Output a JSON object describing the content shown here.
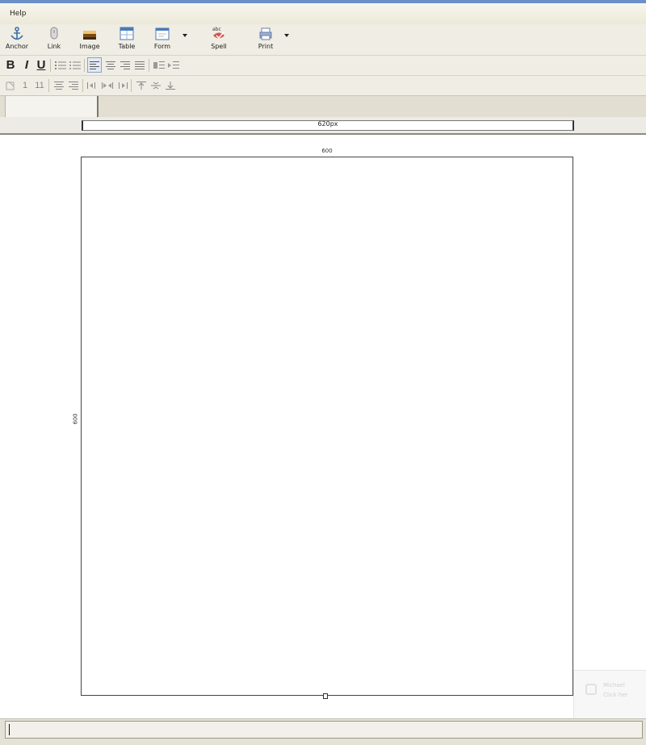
{
  "menu": {
    "help_label": "Help"
  },
  "toolbar": {
    "anchor_label": "Anchor",
    "link_label": "Link",
    "image_label": "Image",
    "table_label": "Table",
    "form_label": "Form",
    "spell_label": "Spell",
    "spell_icon_text": "abc",
    "print_label": "Print"
  },
  "format": {
    "bold": "B",
    "italic": "I",
    "underline": "U",
    "row3_num1": "1",
    "row3_num2": "11"
  },
  "ruler": {
    "width_label": "620px"
  },
  "canvas": {
    "width_label": "600",
    "height_label": "600"
  },
  "notification": {
    "line1": "Michael",
    "line2": "Click her",
    "line3": ""
  },
  "colors": {
    "title_accent": "#6b8fc7",
    "chrome": "#efede4"
  }
}
